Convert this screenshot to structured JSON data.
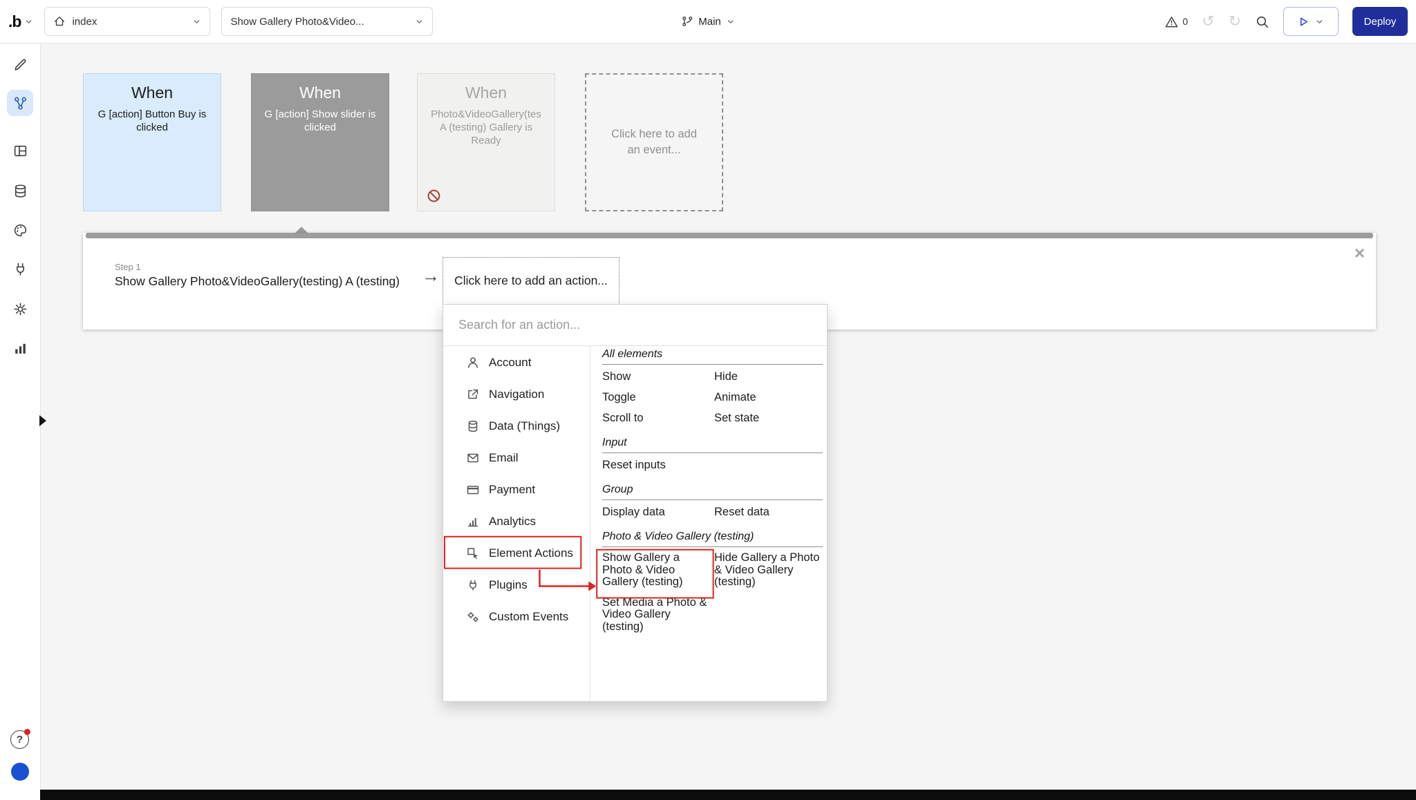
{
  "colors": {
    "annotation_red": "#e02020",
    "deploy_button_bg": "#202e9c",
    "selected_event_bg": "#9b9b9b",
    "event_card_blue_bg": "#d9ebfc",
    "selected_tab_bg": "#d9e9fb",
    "avatar_blue": "#1a50d2"
  },
  "icons": {
    "undo": "↺",
    "redo": "↻",
    "close": "×",
    "arrow_right": "→",
    "help": "?"
  },
  "topbar": {
    "logo_text": ".b",
    "page_dropdown": {
      "value": "index"
    },
    "workflow_dropdown": {
      "value": "Show Gallery Photo&Video..."
    },
    "branch_label": "Main",
    "issues_count": "0",
    "deploy_button": "Deploy"
  },
  "canvas": {
    "events": [
      {
        "title": "When",
        "body": "G [action] Button Buy is clicked"
      },
      {
        "title": "When",
        "body": "G [action] Show slider is clicked"
      },
      {
        "title": "When",
        "body": "Photo&VideoGallery(tes A (testing) Gallery is Ready"
      },
      {
        "placeholder": "Click here to add an event..."
      }
    ]
  },
  "step_panel": {
    "step_label": "Step 1",
    "title": "Show Gallery Photo&VideoGallery(testing) A (testing)",
    "add_action": "Click here to add an action..."
  },
  "action_popup": {
    "search_placeholder": "Search for an action...",
    "categories": [
      {
        "label": "Account"
      },
      {
        "label": "Navigation"
      },
      {
        "label": "Data (Things)"
      },
      {
        "label": "Email"
      },
      {
        "label": "Payment"
      },
      {
        "label": "Analytics"
      },
      {
        "label": "Element Actions"
      },
      {
        "label": "Plugins"
      },
      {
        "label": "Custom Events"
      }
    ],
    "sections": [
      {
        "header": "All elements",
        "rows": [
          [
            "Show",
            "Hide"
          ],
          [
            "Toggle",
            "Animate"
          ],
          [
            "Scroll to",
            "Set state"
          ]
        ]
      },
      {
        "header": "Input",
        "rows": [
          [
            "Reset inputs",
            ""
          ]
        ]
      },
      {
        "header": "Group",
        "rows": [
          [
            "Display data",
            "Reset data"
          ]
        ]
      },
      {
        "header": "Photo & Video Gallery (testing)",
        "rows": [
          [
            "Show Gallery a Photo & Video Gallery (testing)",
            "Hide Gallery a Photo & Video Gallery (testing)"
          ],
          [
            "Set Media a Photo & Video Gallery (testing)",
            ""
          ]
        ]
      }
    ]
  }
}
